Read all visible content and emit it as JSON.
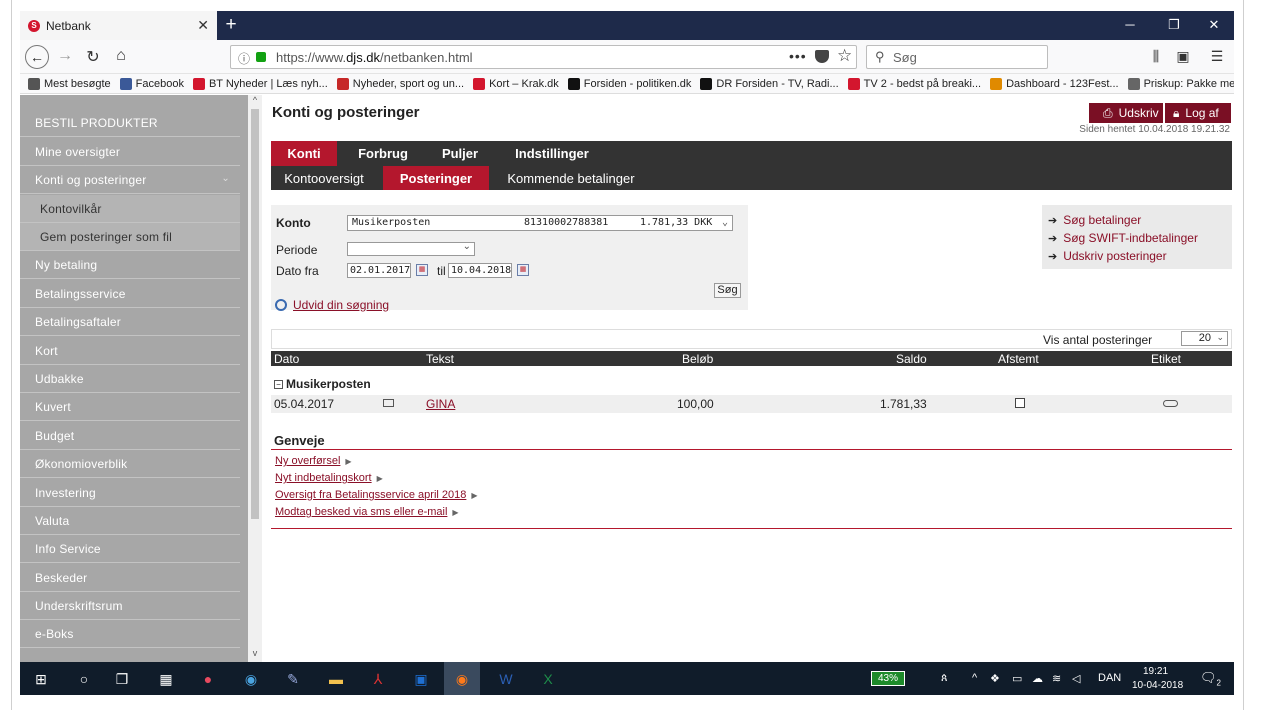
{
  "browser": {
    "tab_title": "Netbank",
    "url_prefix": "https://www.",
    "url_domain": "djs.dk",
    "url_path": "/netbanken.html",
    "search_placeholder": "Søg",
    "bookmarks": [
      {
        "label": "Mest besøgte",
        "icon": "gear-icon",
        "color": "#555555"
      },
      {
        "label": "Facebook",
        "icon": "facebook-icon",
        "color": "#3b5998"
      },
      {
        "label": "BT Nyheder | Læs nyh...",
        "icon": "bt-icon",
        "color": "#d3162e"
      },
      {
        "label": "Nyheder, sport og un...",
        "icon": "news-icon",
        "color": "#c62828"
      },
      {
        "label": "Kort – Krak.dk",
        "icon": "krak-icon",
        "color": "#d3162e"
      },
      {
        "label": "Forsiden - politiken.dk",
        "icon": "politiken-icon",
        "color": "#111111"
      },
      {
        "label": "DR Forsiden - TV, Radi...",
        "icon": "dr-icon",
        "color": "#111111"
      },
      {
        "label": "TV 2 - bedst på breaki...",
        "icon": "tv2-icon",
        "color": "#d3162e"
      },
      {
        "label": "Dashboard - 123Fest...",
        "icon": "dashboard-icon",
        "color": "#e08a00"
      },
      {
        "label": "Priskup: Pakke med Sv...",
        "icon": "globe-icon",
        "color": "#666666"
      }
    ]
  },
  "sidebar": {
    "items": [
      {
        "label": "BESTIL PRODUKTER",
        "sub": false
      },
      {
        "label": "Mine oversigter",
        "sub": false
      },
      {
        "label": "Konti og posteringer",
        "sub": false,
        "expanded": true
      },
      {
        "label": "Kontovilkår",
        "sub": true
      },
      {
        "label": "Gem posteringer som fil",
        "sub": true
      },
      {
        "label": "Ny betaling",
        "sub": false
      },
      {
        "label": "Betalingsservice",
        "sub": false
      },
      {
        "label": "Betalingsaftaler",
        "sub": false
      },
      {
        "label": "Kort",
        "sub": false
      },
      {
        "label": "Udbakke",
        "sub": false
      },
      {
        "label": "Kuvert",
        "sub": false
      },
      {
        "label": "Budget",
        "sub": false
      },
      {
        "label": "Økonomioverblik",
        "sub": false
      },
      {
        "label": "Investering",
        "sub": false
      },
      {
        "label": "Valuta",
        "sub": false
      },
      {
        "label": "Info Service",
        "sub": false
      },
      {
        "label": "Beskeder",
        "sub": false
      },
      {
        "label": "Underskriftsrum",
        "sub": false
      },
      {
        "label": "e-Boks",
        "sub": false
      }
    ]
  },
  "header": {
    "title": "Konti og posteringer",
    "print_label": "Udskriv",
    "logout_label": "Log af",
    "fetched": "Siden hentet 10.04.2018 19.21.32"
  },
  "tabs": {
    "primary": [
      "Konti",
      "Forbrug",
      "Puljer",
      "Indstillinger"
    ],
    "secondary": [
      "Kontooversigt",
      "Posteringer",
      "Kommende betalinger"
    ]
  },
  "filter": {
    "konto_label": "Konto",
    "konto_name": "Musikerposten",
    "konto_number": "81310002788381",
    "konto_balance": "1.781,33 DKK",
    "periode_label": "Periode",
    "dato_label": "Dato fra",
    "date_from": "02.01.2017",
    "til_label": "til",
    "date_to": "10.04.2018",
    "search_button": "Søg",
    "expand_link": "Udvid din søgning"
  },
  "quicklinks": [
    "Søg betalinger",
    "Søg SWIFT-indbetalinger",
    "Udskriv posteringer"
  ],
  "table": {
    "show_label": "Vis antal posteringer",
    "show_count": "20",
    "headers": [
      "Dato",
      "Tekst",
      "Beløb",
      "Saldo",
      "Afstemt",
      "Etiket"
    ],
    "group": "Musikerposten",
    "rows": [
      {
        "date": "05.04.2017",
        "text": "GINA",
        "amount": "100,00",
        "balance": "1.781,33"
      }
    ]
  },
  "genveje": {
    "title": "Genveje",
    "links": [
      "Ny overførsel",
      "Nyt indbetalingskort",
      "Oversigt fra Betalingsservice april 2018",
      "Modtag besked via sms eller e-mail"
    ]
  },
  "taskbar": {
    "battery": "43%",
    "language": "DAN",
    "time": "19:21",
    "date": "10-04-2018",
    "notifications": "2"
  },
  "colors": {
    "brand": "#b4172d",
    "dark_brand": "#7a0f24",
    "link": "#8a1028"
  }
}
